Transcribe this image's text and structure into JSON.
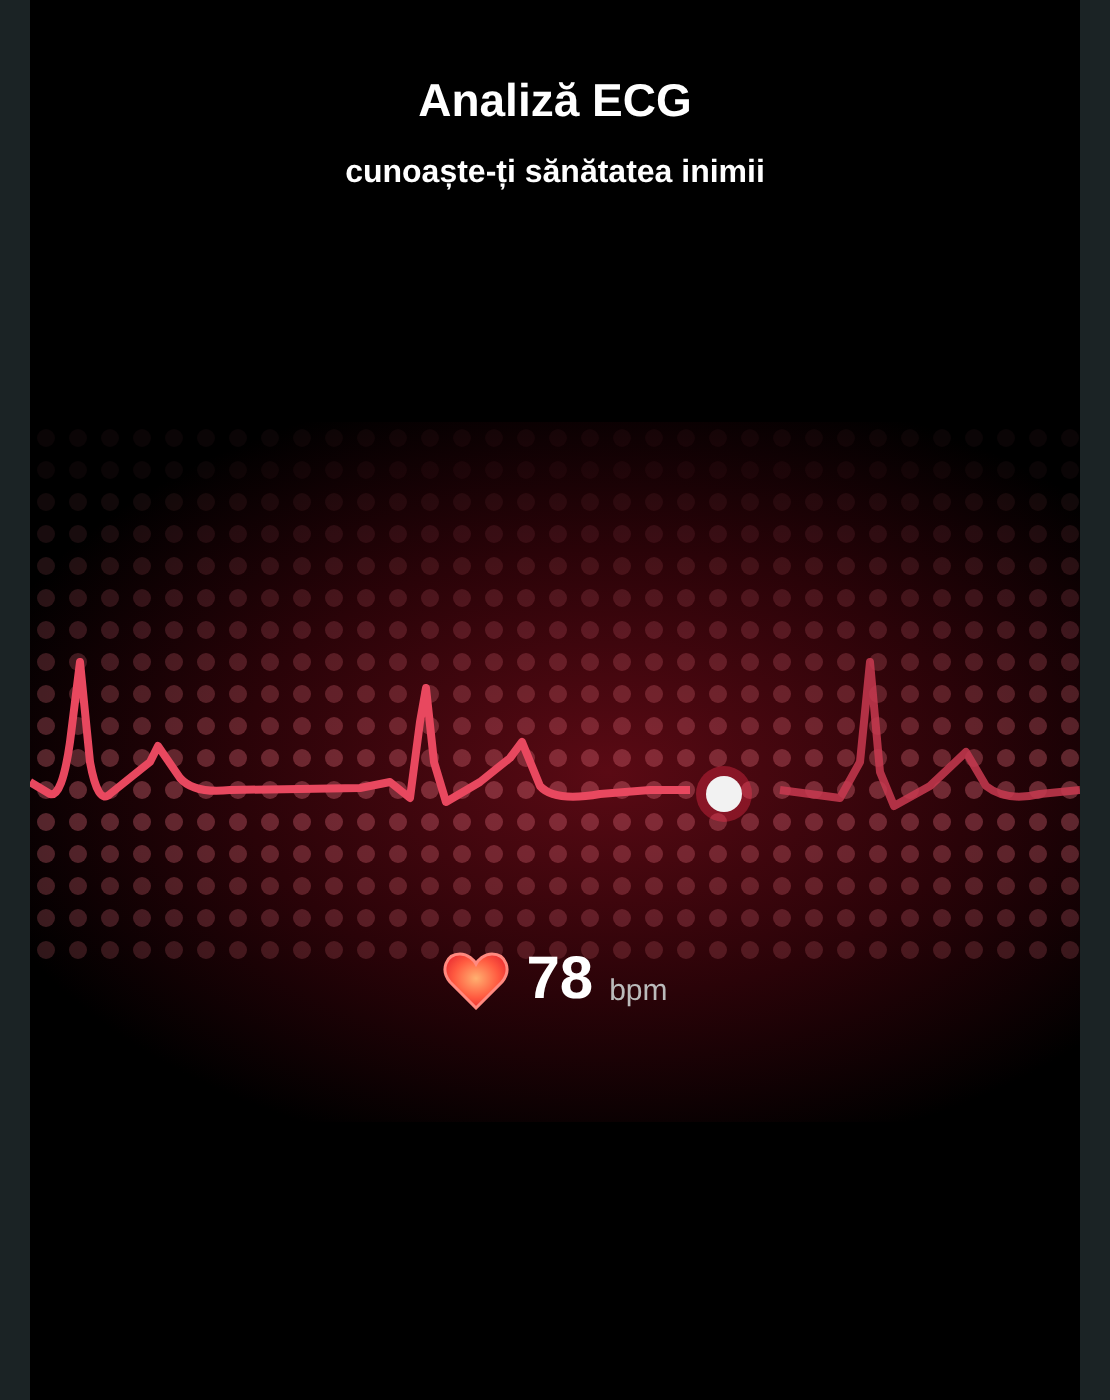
{
  "header": {
    "title": "Analiză ECG",
    "subtitle": "cunoaște-ți sănătatea inimii"
  },
  "heart_rate": {
    "value": "78",
    "unit": "bpm"
  }
}
